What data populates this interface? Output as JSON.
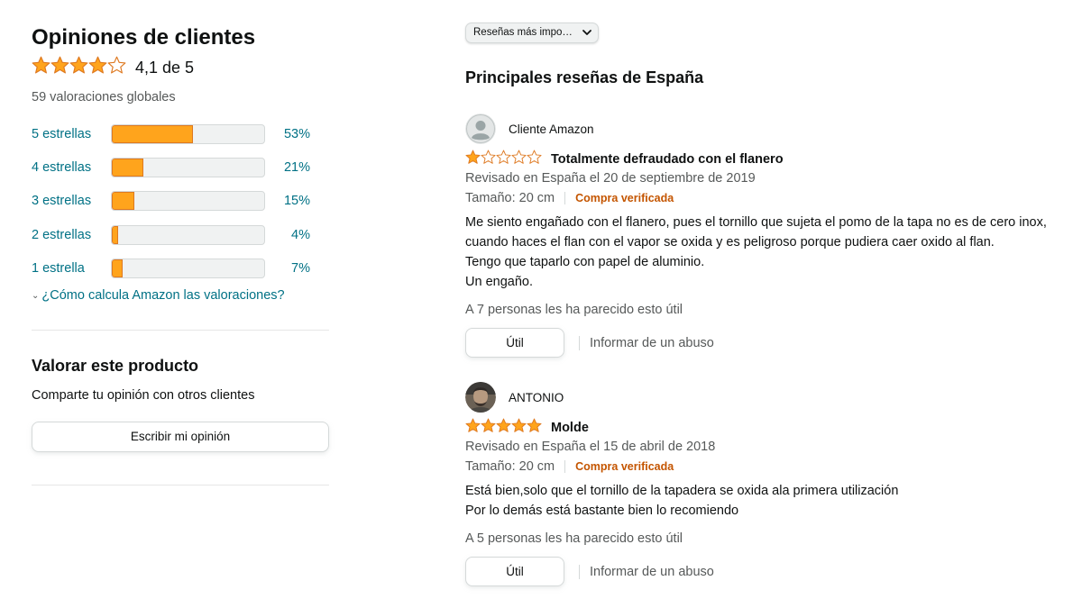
{
  "left": {
    "title": "Opiniones de clientes",
    "rating": {
      "stars": 4.1,
      "text": "4,1 de 5"
    },
    "global_ratings": "59 valoraciones globales",
    "histogram": [
      {
        "label": "5 estrellas",
        "percent": 53,
        "percent_text": "53%"
      },
      {
        "label": "4 estrellas",
        "percent": 21,
        "percent_text": "21%"
      },
      {
        "label": "3 estrellas",
        "percent": 15,
        "percent_text": "15%"
      },
      {
        "label": "2 estrellas",
        "percent": 4,
        "percent_text": "4%"
      },
      {
        "label": "1 estrella",
        "percent": 7,
        "percent_text": "7%"
      }
    ],
    "how_calc": "¿Cómo calcula Amazon las valoraciones?",
    "rate_title": "Valorar este producto",
    "share_text": "Comparte tu opinión con otros clientes",
    "write_button": "Escribir mi opinión"
  },
  "right": {
    "sort_label": "Reseñas más impo…",
    "reviews_title": "Principales reseñas de España",
    "reviews": [
      {
        "author": "Cliente Amazon",
        "avatar_icon": "default-user-icon",
        "stars": 1,
        "title": "Totalmente defraudado con el flanero",
        "date": "Revisado en España el 20 de septiembre de 2019",
        "size": "Tamaño: 20 cm",
        "verified": "Compra verificada",
        "body": [
          "Me siento engañado con el flanero, pues el tornillo que sujeta el pomo de la tapa no es de cero inox,",
          "cuando haces el flan con el vapor se oxida y es peligroso porque pudiera caer oxido al flan.",
          "Tengo que taparlo con papel de aluminio.",
          "Un engaño."
        ],
        "helpful": "A 7 personas les ha parecido esto útil",
        "helpful_button": "Útil",
        "report": "Informar de un abuso"
      },
      {
        "author": "ANTONIO",
        "avatar_icon": "user-photo-icon",
        "stars": 5,
        "title": "Molde",
        "date": "Revisado en España el 15 de abril de 2018",
        "size": "Tamaño: 20 cm",
        "verified": "Compra verificada",
        "body": [
          "Está bien,solo que el tornillo de la tapadera se oxida ala primera utilización",
          "Por lo demás está bastante bien lo recomiendo"
        ],
        "helpful": "A 5 personas les ha parecido esto útil",
        "helpful_button": "Útil",
        "report": "Informar de un abuso"
      }
    ]
  },
  "colors": {
    "star": "#ffa41c",
    "star_stroke": "#de7921",
    "link": "#007185",
    "verified": "#c45500"
  }
}
